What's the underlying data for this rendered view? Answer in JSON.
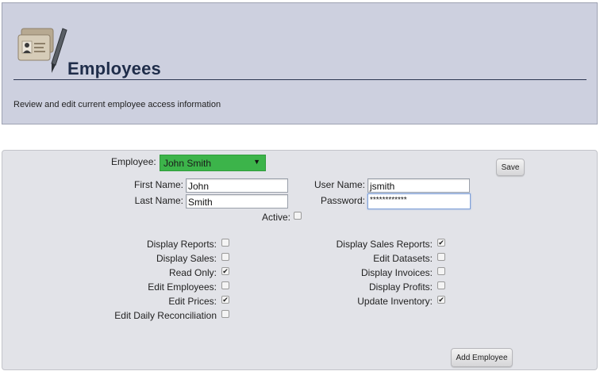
{
  "header": {
    "title": "Employees",
    "subtitle": "Review and edit current employee access information",
    "icon": "id-cards-pen-icon"
  },
  "form": {
    "employee_label": "Employee:",
    "employee_selected": "John Smith",
    "save_label": "Save",
    "first_name_label": "First Name:",
    "first_name_value": "John",
    "last_name_label": "Last Name:",
    "last_name_value": "Smith",
    "user_name_label": "User Name:",
    "user_name_value": "jsmith",
    "password_label": "Password:",
    "password_value": "************",
    "active_label": "Active:",
    "active_checked": false,
    "add_employee_label": "Add Employee"
  },
  "permissions_left": [
    {
      "label": "Display Reports:",
      "checked": false
    },
    {
      "label": "Display Sales:",
      "checked": false
    },
    {
      "label": "Read Only:",
      "checked": true
    },
    {
      "label": "Edit Employees:",
      "checked": false
    },
    {
      "label": "Edit Prices:",
      "checked": true
    },
    {
      "label": "Edit Daily Reconciliation",
      "checked": false
    }
  ],
  "permissions_right": [
    {
      "label": "Display Sales Reports:",
      "checked": true
    },
    {
      "label": "Edit Datasets:",
      "checked": false
    },
    {
      "label": "Display Invoices:",
      "checked": false
    },
    {
      "label": "Display Profits:",
      "checked": false
    },
    {
      "label": "Update Inventory:",
      "checked": true
    }
  ],
  "colors": {
    "header_bg": "#cdd0df",
    "form_bg": "#e2e3e8",
    "select_bg": "#3cb44a",
    "title_color": "#1f2d4a"
  }
}
